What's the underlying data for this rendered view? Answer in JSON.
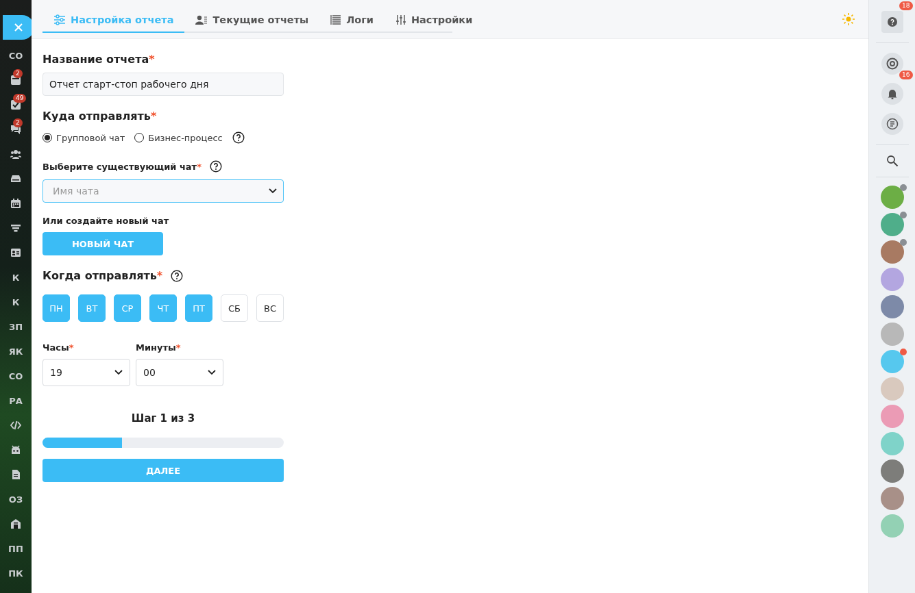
{
  "left_sidebar": {
    "items": [
      {
        "kind": "text",
        "label": "СО"
      },
      {
        "kind": "icon",
        "badge": "2"
      },
      {
        "kind": "icon",
        "badge": "49"
      },
      {
        "kind": "icon",
        "badge": "2"
      },
      {
        "kind": "icon"
      },
      {
        "kind": "icon"
      },
      {
        "kind": "icon"
      },
      {
        "kind": "icon"
      },
      {
        "kind": "icon"
      },
      {
        "kind": "text",
        "label": "К"
      },
      {
        "kind": "text",
        "label": "К"
      },
      {
        "kind": "text",
        "label": "ЗП"
      },
      {
        "kind": "text",
        "label": "ЯК"
      },
      {
        "kind": "text",
        "label": "СО"
      },
      {
        "kind": "text",
        "label": "РА"
      },
      {
        "kind": "icon"
      },
      {
        "kind": "icon"
      },
      {
        "kind": "icon"
      },
      {
        "kind": "text",
        "label": "ОЗ"
      },
      {
        "kind": "icon"
      },
      {
        "kind": "text",
        "label": "ПП"
      },
      {
        "kind": "text",
        "label": "ПК"
      }
    ]
  },
  "tabs": [
    {
      "label": "Настройка отчета",
      "selected": true
    },
    {
      "label": "Текущие отчеты",
      "selected": false
    },
    {
      "label": "Логи",
      "selected": false
    },
    {
      "label": "Настройки",
      "selected": false
    }
  ],
  "form": {
    "name_label": "Название отчета",
    "name_value": "Отчет старт-стоп рабочего дня",
    "target_label": "Куда отправлять",
    "target_options": [
      {
        "label": "Групповой чат",
        "selected": true
      },
      {
        "label": "Бизнес-процесс",
        "selected": false
      }
    ],
    "chat_label": "Выберите существующий чат",
    "chat_placeholder": "Имя чата",
    "new_chat_label": "Или создайте новый чат",
    "new_chat_button": "НОВЫЙ ЧАТ",
    "when_label": "Когда отправлять",
    "days": [
      {
        "label": "ПН",
        "selected": true
      },
      {
        "label": "ВТ",
        "selected": true
      },
      {
        "label": "СР",
        "selected": true
      },
      {
        "label": "ЧТ",
        "selected": true
      },
      {
        "label": "ПТ",
        "selected": true
      },
      {
        "label": "СБ",
        "selected": false
      },
      {
        "label": "ВС",
        "selected": false
      }
    ],
    "hours_label": "Часы",
    "hours_value": "19",
    "minutes_label": "Минуты",
    "minutes_value": "00",
    "required_mark": "*",
    "step_text": "Шаг 1 из 3",
    "progress": {
      "level": 0.33
    },
    "next_button": "ДАЛЕЕ"
  },
  "right_sidebar": {
    "help_badge": "18",
    "bell_badge": "16",
    "avatars": [
      {
        "color": "#6cae45",
        "dot": {
          "color": "#8a8f94"
        }
      },
      {
        "color": "#4fae8a",
        "dot": {
          "color": "#8a8f94"
        }
      },
      {
        "color": "#a87a62",
        "dot": {
          "color": "#8a8f94"
        }
      },
      {
        "color": "#b3a6e0"
      },
      {
        "color": "#7d8aa8"
      },
      {
        "color": "#b8b8b8"
      },
      {
        "color": "#56c8ee",
        "dot": {
          "color": "#ef5a45"
        }
      },
      {
        "color": "#d9c9be"
      },
      {
        "color": "#eb9bb5"
      },
      {
        "color": "#7fd3c9"
      },
      {
        "color": "#7d7d7a"
      },
      {
        "color": "#a89088"
      },
      {
        "color": "#93d1b4"
      }
    ]
  }
}
